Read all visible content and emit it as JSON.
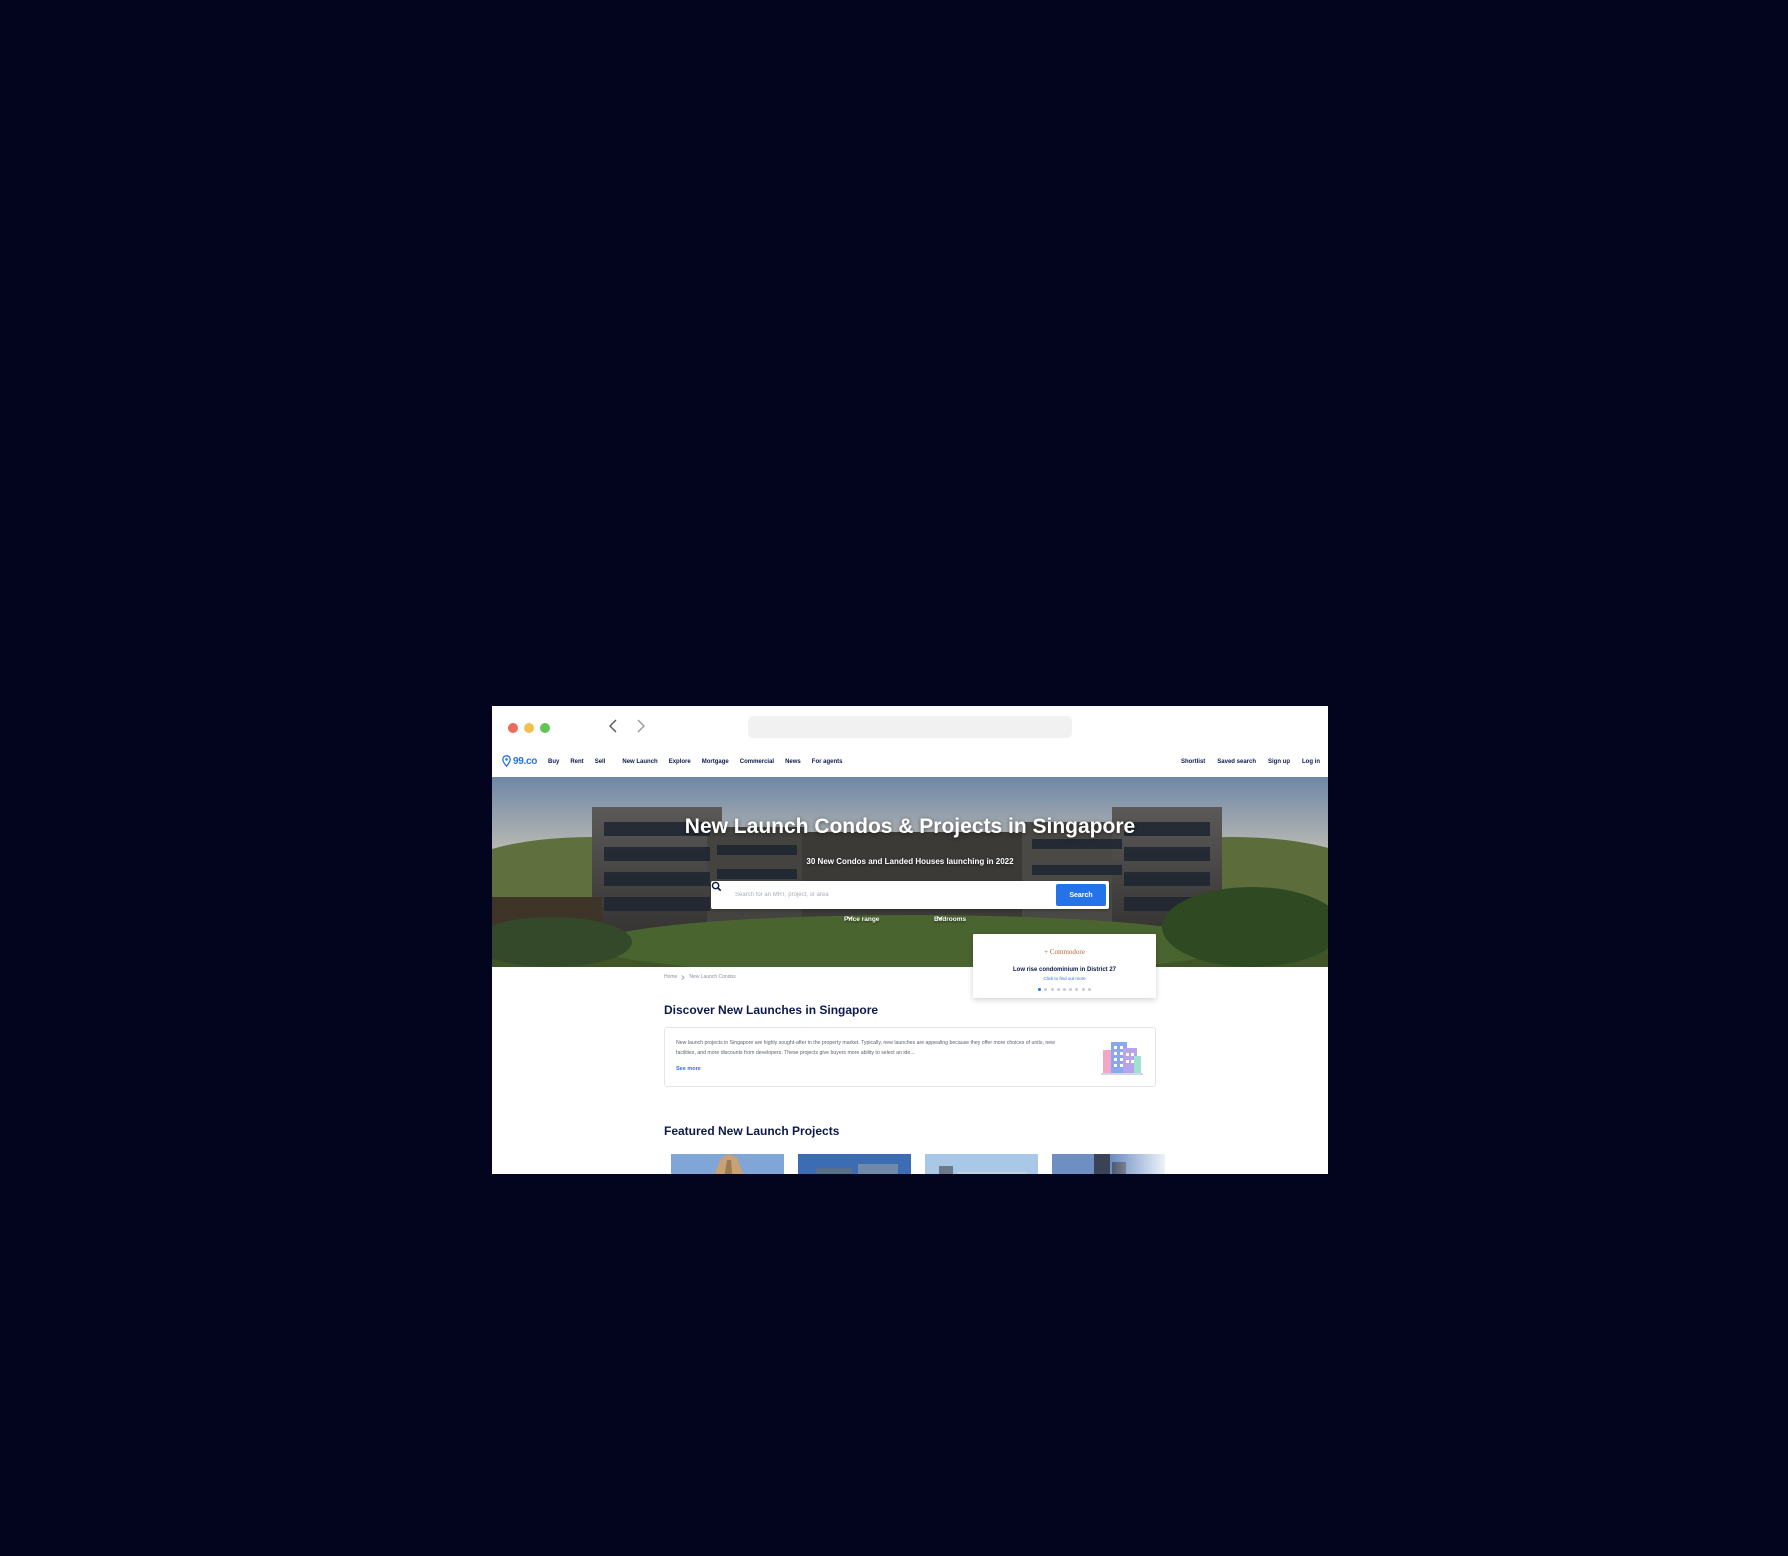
{
  "site": {
    "logo_text": "99.co",
    "nav_left": [
      "Buy",
      "Rent",
      "Sell",
      "New Launch",
      "Explore",
      "Mortgage",
      "Commercial",
      "News",
      "For agents"
    ],
    "nav_right": [
      "Shortlist",
      "Saved search",
      "Sign up",
      "Log in"
    ]
  },
  "hero": {
    "title": "New Launch Condos & Projects in Singapore",
    "subtitle": "30 New Condos and Landed Houses launching in 2022",
    "search_placeholder": "Search for an MRT, project, or area",
    "search_button": "Search",
    "filters": [
      "Price range",
      "Bedrooms"
    ]
  },
  "promo": {
    "brand": "+ Commodore",
    "title": "Low rise condominium in District 27",
    "link": "Click to find out more",
    "dots_total": 9,
    "active_dot": 1
  },
  "breadcrumb": [
    "Home",
    "New Launch Condos"
  ],
  "discover": {
    "title": "Discover New Launches in Singapore",
    "text": "New launch projects in Singapore are highly sought-after in the property market. Typically, new launches are appealing because they offer more choices of units, new facilities, and more discounts from developers. These projects give buyers more ability to select an ide...",
    "see_more": "See more"
  },
  "featured": {
    "title": "Featured New Launch Projects"
  },
  "colors": {
    "page_background": "#03041e",
    "brand_blue": "#2573e8",
    "navy_text": "#0c1a4b"
  }
}
